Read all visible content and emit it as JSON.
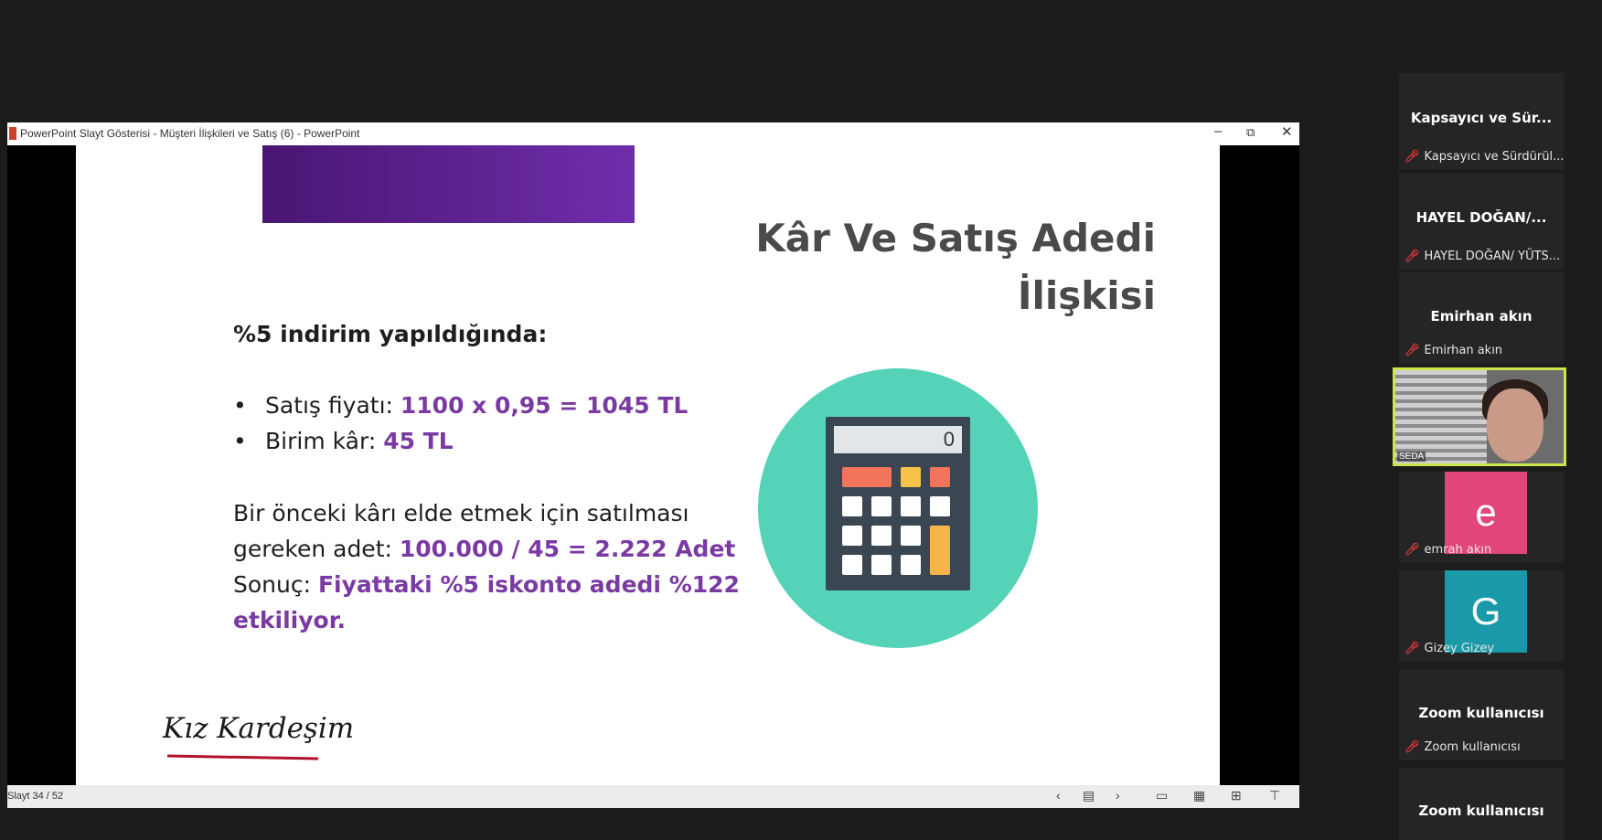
{
  "window": {
    "title": "PowerPoint Slayt Gösterisi  -  Müşteri İlişkileri ve Satış (6) - PowerPoint",
    "minimize_glyph": "–",
    "restore_glyph": "⧉",
    "close_glyph": "✕"
  },
  "slide": {
    "title_line1": "Kâr Ve Satış Adedi",
    "title_line2": "İlişkisi",
    "heading": "%5 indirim yapıldığında:",
    "bullet1_label": "Satış fiyatı: ",
    "bullet1_value": "1100 x 0,95 = 1045 TL",
    "bullet2_label": "Birim kâr: ",
    "bullet2_value": "45 TL",
    "para1_text_line1": "Bir önceki kârı elde etmek için satılması",
    "para1_text_line2": "gereken adet: ",
    "para1_value": "100.000 / 45 = 2.222 Adet",
    "para2_label": "Sonuç: ",
    "para2_value": "Fiyattaki %5 iskonto adedi %122 etkiliyor.",
    "logo_text": "Kız Kardeşim",
    "calculator_display": "0",
    "accent_color": "#7a3aa3"
  },
  "statusbar": {
    "slide_count": "Slayt 34 / 52",
    "icons": [
      "prev-icon",
      "menu-icon",
      "next-icon",
      "normal-view-icon",
      "slide-sorter-icon",
      "reading-view-icon",
      "slideshow-icon"
    ]
  },
  "participants": [
    {
      "title": "Kapsayıcı ve Sür...",
      "name": "Kapsayıcı ve Sürdürül..."
    },
    {
      "title": "HAYEL DOĞAN/...",
      "name": "HAYEL DOĞAN/ YÜTS..."
    },
    {
      "title": "Emirhan akın",
      "name": "Emirhan akın"
    },
    {
      "video_name": "SEDA"
    },
    {
      "initial": "e",
      "name": "emrah akın",
      "color": "#e2457c"
    },
    {
      "initial": "G",
      "name": "Gizey Gizey",
      "color": "#1a9aa8"
    },
    {
      "title": "Zoom kullanıcısı",
      "name": "Zoom kullanıcısı"
    },
    {
      "title": "Zoom kullanıcısı"
    }
  ]
}
